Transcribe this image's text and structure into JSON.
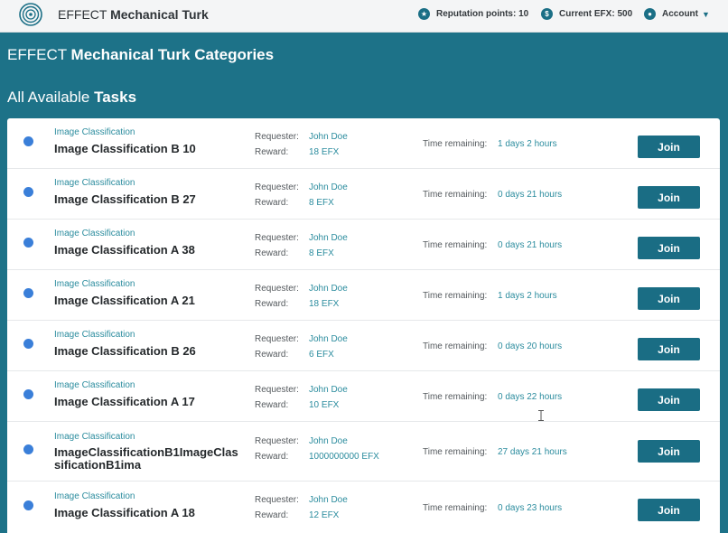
{
  "header": {
    "brand_prefix": "EFFECT",
    "brand_name": "Mechanical Turk",
    "logo_icon": "effect-logo-icon",
    "reputation_label": "Reputation points: 10",
    "efx_label": "Current EFX: 500",
    "account_label": "Account"
  },
  "page": {
    "heading_prefix": "EFFECT",
    "heading_bold": "Mechanical Turk Categories",
    "subheading_prefix": "All Available",
    "subheading_bold": "Tasks"
  },
  "labels": {
    "requester": "Requester:",
    "reward": "Reward:",
    "time_remaining": "Time remaining:",
    "join": "Join"
  },
  "tasks": [
    {
      "category": "Image Classification",
      "title": "Image Classification B 10",
      "requester": "John Doe",
      "reward": "18 EFX",
      "time": "1 days 2 hours"
    },
    {
      "category": "Image Classification",
      "title": "Image Classification B 27",
      "requester": "John Doe",
      "reward": "8 EFX",
      "time": "0 days 21 hours"
    },
    {
      "category": "Image Classification",
      "title": "Image Classification A 38",
      "requester": "John Doe",
      "reward": "8 EFX",
      "time": "0 days 21 hours"
    },
    {
      "category": "Image Classification",
      "title": "Image Classification A 21",
      "requester": "John Doe",
      "reward": "18 EFX",
      "time": "1 days 2 hours"
    },
    {
      "category": "Image Classification",
      "title": "Image Classification B 26",
      "requester": "John Doe",
      "reward": "6 EFX",
      "time": "0 days 20 hours"
    },
    {
      "category": "Image Classification",
      "title": "Image Classification A 17",
      "requester": "John Doe",
      "reward": "10 EFX",
      "time": "0 days 22 hours"
    },
    {
      "category": "Image Classification",
      "title": "ImageClassificationB1ImageClassificationB1ima",
      "requester": "John Doe",
      "reward": "1000000000 EFX",
      "time": "27 days 21 hours"
    },
    {
      "category": "Image Classification",
      "title": "Image Classification A 18",
      "requester": "John Doe",
      "reward": "12 EFX",
      "time": "0 days 23 hours"
    }
  ],
  "colors": {
    "background": "#1d7288",
    "accent": "#1a6d84",
    "link": "#2b8c9e",
    "status_dot": "#3a7fd9"
  }
}
